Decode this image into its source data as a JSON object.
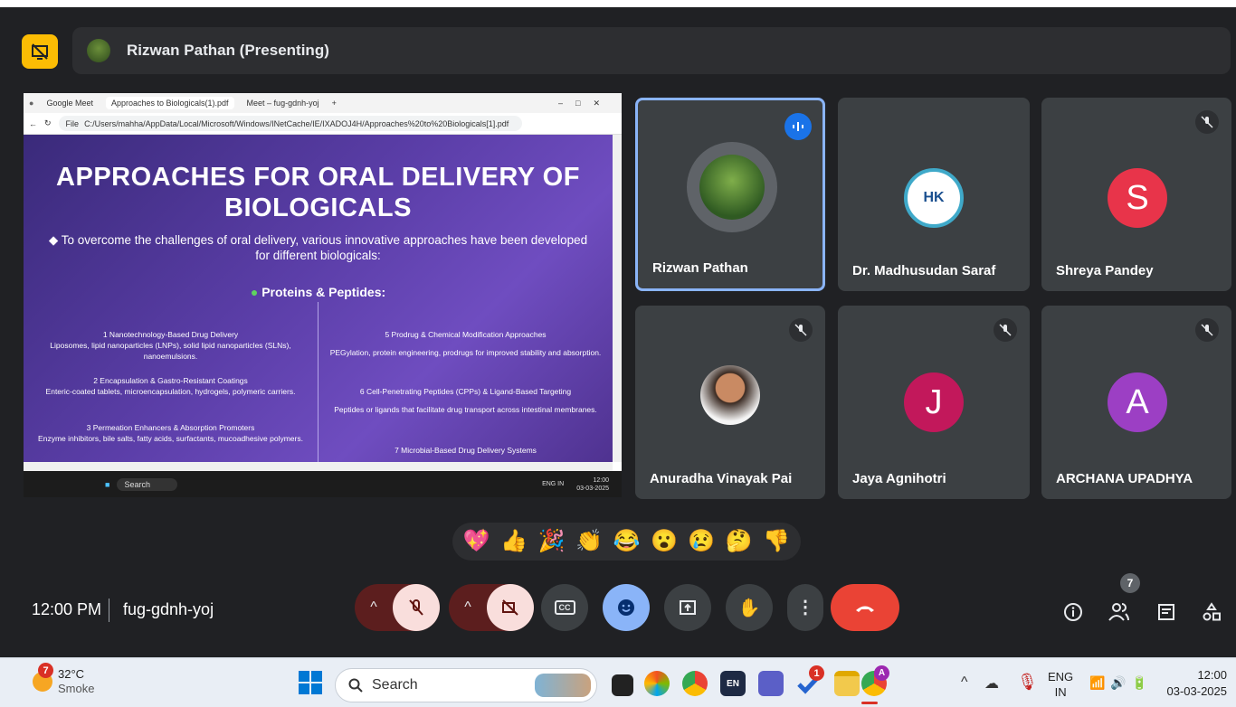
{
  "presenter": {
    "label": "Rizwan Pathan (Presenting)"
  },
  "browser": {
    "tabs": [
      "Google Meet",
      "Approaches to Biologicals(1).pdf",
      "Meet – fug-gdnh-yoj"
    ],
    "file_label": "File",
    "url": "C:/Users/mahha/AppData/Local/Microsoft/Windows/INetCache/IE/IXADOJ4H/Approaches%20to%20Biologicals[1].pdf"
  },
  "slide": {
    "title": "APPROACHES FOR ORAL DELIVERY OF BIOLOGICALS",
    "intro": "To overcome the challenges of oral delivery, various innovative approaches have been developed for different biologicals:",
    "heading": "Proteins & Peptides:",
    "left_items": [
      {
        "title": "1 Nanotechnology-Based Drug Delivery",
        "desc": "Liposomes, lipid nanoparticles (LNPs), solid lipid nanoparticles (SLNs), nanoemulsions."
      },
      {
        "title": "2 Encapsulation & Gastro-Resistant Coatings",
        "desc": "Enteric-coated tablets, microencapsulation, hydrogels, polymeric carriers."
      },
      {
        "title": "3 Permeation Enhancers & Absorption Promoters",
        "desc": "Enzyme inhibitors, bile salts, fatty acids, surfactants, mucoadhesive polymers."
      }
    ],
    "right_items": [
      {
        "title": "5 Prodrug & Chemical Modification Approaches",
        "desc": "PEGylation, protein engineering, prodrugs for improved stability and absorption."
      },
      {
        "title": "6 Cell-Penetrating Peptides (CPPs) & Ligand-Based Targeting",
        "desc": "Peptides or ligands that facilitate drug transport across intestinal membranes."
      },
      {
        "title": "7 Microbial-Based Drug Delivery Systems",
        "desc": ""
      }
    ]
  },
  "inner_taskbar": {
    "search": "Search",
    "lang": "ENG IN",
    "time": "12:00",
    "date": "03-03-2025"
  },
  "participants": [
    {
      "name": "Rizwan Pathan",
      "speaking": true
    },
    {
      "name": "Dr. Madhusudan Saraf",
      "logo_text": "HK"
    },
    {
      "name": "Shreya Pandey",
      "initial": "S",
      "color": "#e8344a"
    },
    {
      "name": "Anuradha Vinayak Pai"
    },
    {
      "name": "Jaya Agnihotri",
      "initial": "J",
      "color": "#c2185b"
    },
    {
      "name": "ARCHANA UPADHYA",
      "initial": "A",
      "color": "#9c3fc4"
    }
  ],
  "reactions": [
    "💖",
    "👍",
    "🎉",
    "👏",
    "😂",
    "😮",
    "😢",
    "🤔",
    "👎"
  ],
  "meeting": {
    "time": "12:00 PM",
    "code": "fug-gdnh-yoj",
    "people_count": "7"
  },
  "taskbar": {
    "weather_badge": "7",
    "temperature": "32°C",
    "weather": "Smoke",
    "search": "Search",
    "lang_line1": "ENG",
    "lang_line2": "IN",
    "time": "12:00",
    "date": "03-03-2025",
    "notify_badge": "1",
    "chrome_badge": "A",
    "en_label": "EN"
  },
  "colors": {
    "accent": "#8ab4f8",
    "end_call": "#ea4335",
    "present_icon": "#fbbc04"
  }
}
